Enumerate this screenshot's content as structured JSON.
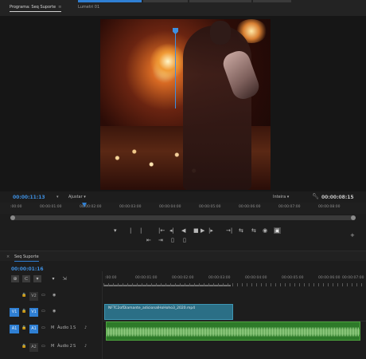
{
  "tabs": {
    "program": "Programa: Seq Suporte",
    "program_close": "≡",
    "lumetri": "Lumetri 01"
  },
  "monitor": {
    "left_timecode": "00:00:11:13",
    "fit_label": "Ajustar",
    "full_label": "Inteira",
    "right_timecode": "00:00:08:15",
    "ruler_labels": [
      ":00:00",
      "00:00:01:00",
      "00:00:02:00",
      "00:00:03:00",
      "00:00:04:00",
      "00:00:05:00",
      "00:00:06:00",
      "00:00:07:00",
      "00:00:08:00"
    ]
  },
  "transport": {
    "row1": [
      "▾",
      "|",
      "|",
      "|←",
      "◂|",
      "◀",
      "■",
      "▶",
      "|▸",
      "→|",
      "⇆",
      "⇆",
      "◉",
      "▣"
    ],
    "row2": [
      "⇤",
      "⇥",
      "▯",
      "▯"
    ],
    "add": "+"
  },
  "timeline": {
    "tab_label": "Seq Suporte",
    "tab_close": "×",
    "timecode": "00:00:01:16",
    "ruler_labels": [
      ":00:00",
      "00:00:01:00",
      "00:00:02:00",
      "00:00:03:00",
      "00:00:04:00",
      "00:00:05:00",
      "00:00:06:00",
      "00:00:07:00"
    ],
    "tools": [
      "⊕",
      "⊂",
      "▾",
      "▾",
      "⇲"
    ],
    "tracks": [
      {
        "id": "V2",
        "lock": "🔒",
        "sync": "▭",
        "eye": "◉"
      },
      {
        "id": "V1",
        "lock": "🔒",
        "sync": "▭",
        "eye": "◉",
        "src": "V1"
      },
      {
        "id": "A1",
        "lock": "🔒",
        "sync": "▭",
        "src": "A1",
        "mute": "M",
        "solo": "S",
        "mic": "♪",
        "label": "Áudio 1"
      },
      {
        "id": "A2",
        "lock": "🔒",
        "sync": "▭",
        "mute": "M",
        "solo": "S",
        "mic": "♪",
        "label": "Áudio 2"
      }
    ],
    "video_clip_name": "NFTC2ofDiamante_adicionalHoHoho3_2020.mp4"
  },
  "colors": {
    "accent": "#2f7fd3",
    "video_clip": "#2b6f86",
    "audio_clip": "#2d7a29"
  }
}
